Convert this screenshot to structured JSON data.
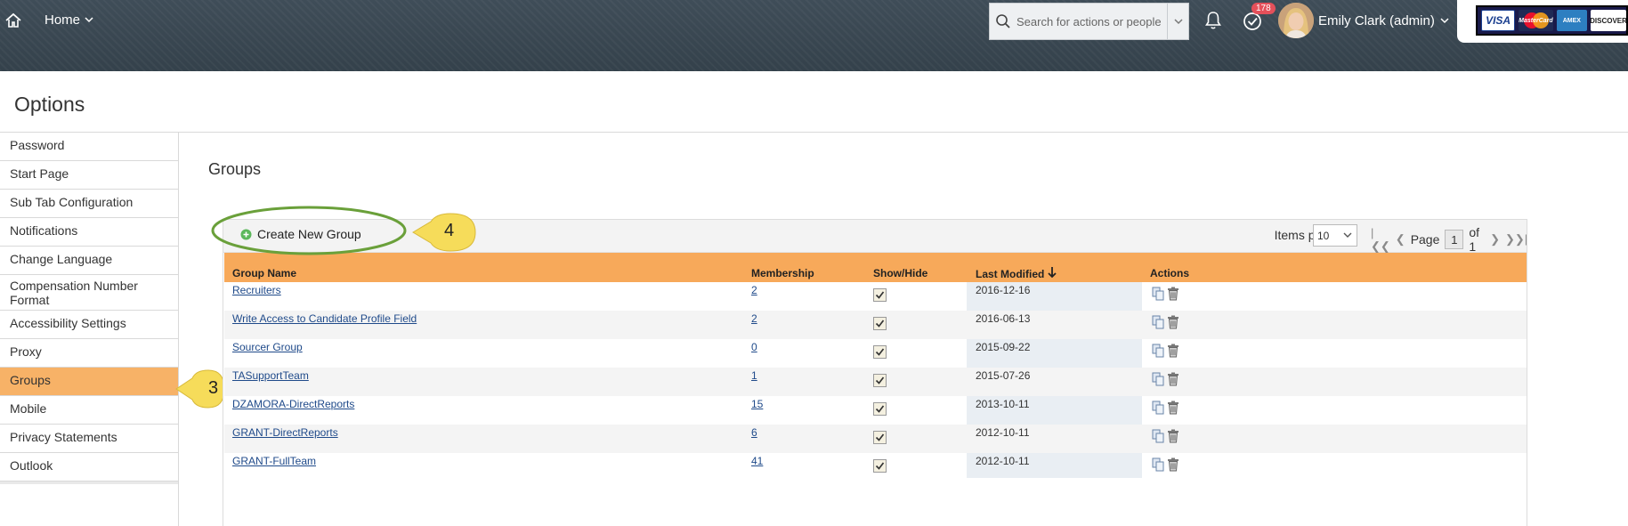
{
  "header": {
    "home_label": "Home",
    "search_placeholder": "Search for actions or people",
    "todo_count": "178",
    "user_name": "Emily Clark (admin)",
    "cards": [
      "VISA",
      "MasterCard",
      "AMEX",
      "DISCOVER"
    ]
  },
  "page": {
    "title": "Options"
  },
  "sidebar": {
    "items": [
      {
        "label": "Password"
      },
      {
        "label": "Start Page"
      },
      {
        "label": "Sub Tab Configuration"
      },
      {
        "label": "Notifications"
      },
      {
        "label": "Change Language"
      },
      {
        "label": "Compensation Number Format"
      },
      {
        "label": "Accessibility Settings"
      },
      {
        "label": "Proxy"
      },
      {
        "label": "Groups",
        "active": true
      },
      {
        "label": "Mobile"
      },
      {
        "label": "Privacy Statements"
      },
      {
        "label": "Outlook"
      }
    ]
  },
  "callouts": {
    "sidebar": "3",
    "create": "4"
  },
  "groups": {
    "title": "Groups",
    "create_label": "Create New Group",
    "items_per_page_label": "Items per page",
    "items_per_page_value": "10",
    "page_label": "Page",
    "page_value": "1",
    "page_of": "of 1",
    "columns": [
      "Group Name",
      "Membership",
      "Show/Hide",
      "Last Modified",
      "Actions"
    ],
    "rows": [
      {
        "name": "Recruiters",
        "membership": "2",
        "shown": true,
        "modified": "2016-12-16"
      },
      {
        "name": "Write Access to Candidate Profile Field",
        "membership": "2",
        "shown": true,
        "modified": "2016-06-13"
      },
      {
        "name": "Sourcer Group",
        "membership": "0",
        "shown": true,
        "modified": "2015-09-22"
      },
      {
        "name": "TASupportTeam",
        "membership": "1",
        "shown": true,
        "modified": "2015-07-26"
      },
      {
        "name": "DZAMORA-DirectReports",
        "membership": "15",
        "shown": true,
        "modified": "2013-10-11"
      },
      {
        "name": "GRANT-DirectReports",
        "membership": "6",
        "shown": true,
        "modified": "2012-10-11"
      },
      {
        "name": "GRANT-FullTeam",
        "membership": "41",
        "shown": true,
        "modified": "2012-10-11"
      }
    ]
  },
  "colors": {
    "accent": "#f7a95a",
    "active_nav": "#f7b267",
    "header_bg": "#3a4852",
    "link": "#1f4a8a",
    "callout_fill": "#f6dc5a",
    "callout_ring": "#6aa03a"
  }
}
